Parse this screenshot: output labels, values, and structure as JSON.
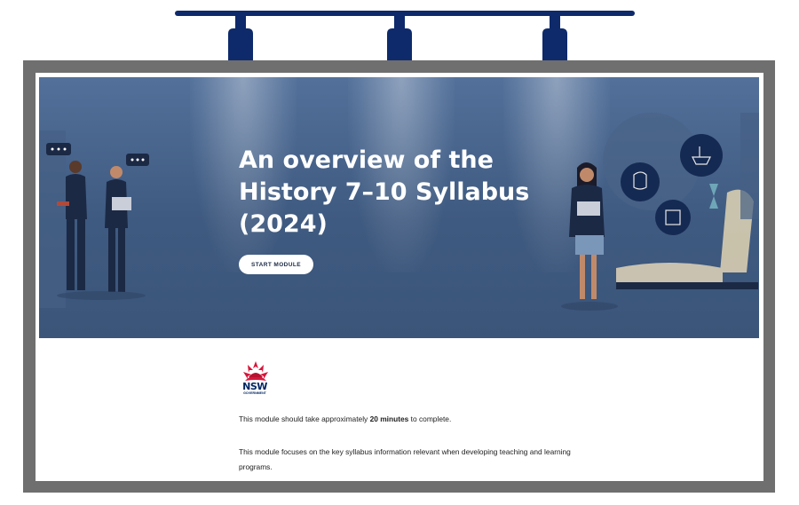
{
  "hero": {
    "title_line1": "An overview of the",
    "title_line2": "History 7–10 Syllabus",
    "title_line3": "(2024)",
    "start_label": "START MODULE"
  },
  "logo": {
    "name": "NSW",
    "sub": "GOVERNMENT"
  },
  "content": {
    "duration_prefix": "This module should take approximately ",
    "duration_value": "20 minutes",
    "duration_suffix": " to complete.",
    "focus_text": "This module focuses on the key syllabus information relevant when developing teaching and learning programs."
  },
  "colors": {
    "accent": "#0e2a6b",
    "hero_bg": "#3f5a80",
    "nsw_red": "#d7153a"
  }
}
